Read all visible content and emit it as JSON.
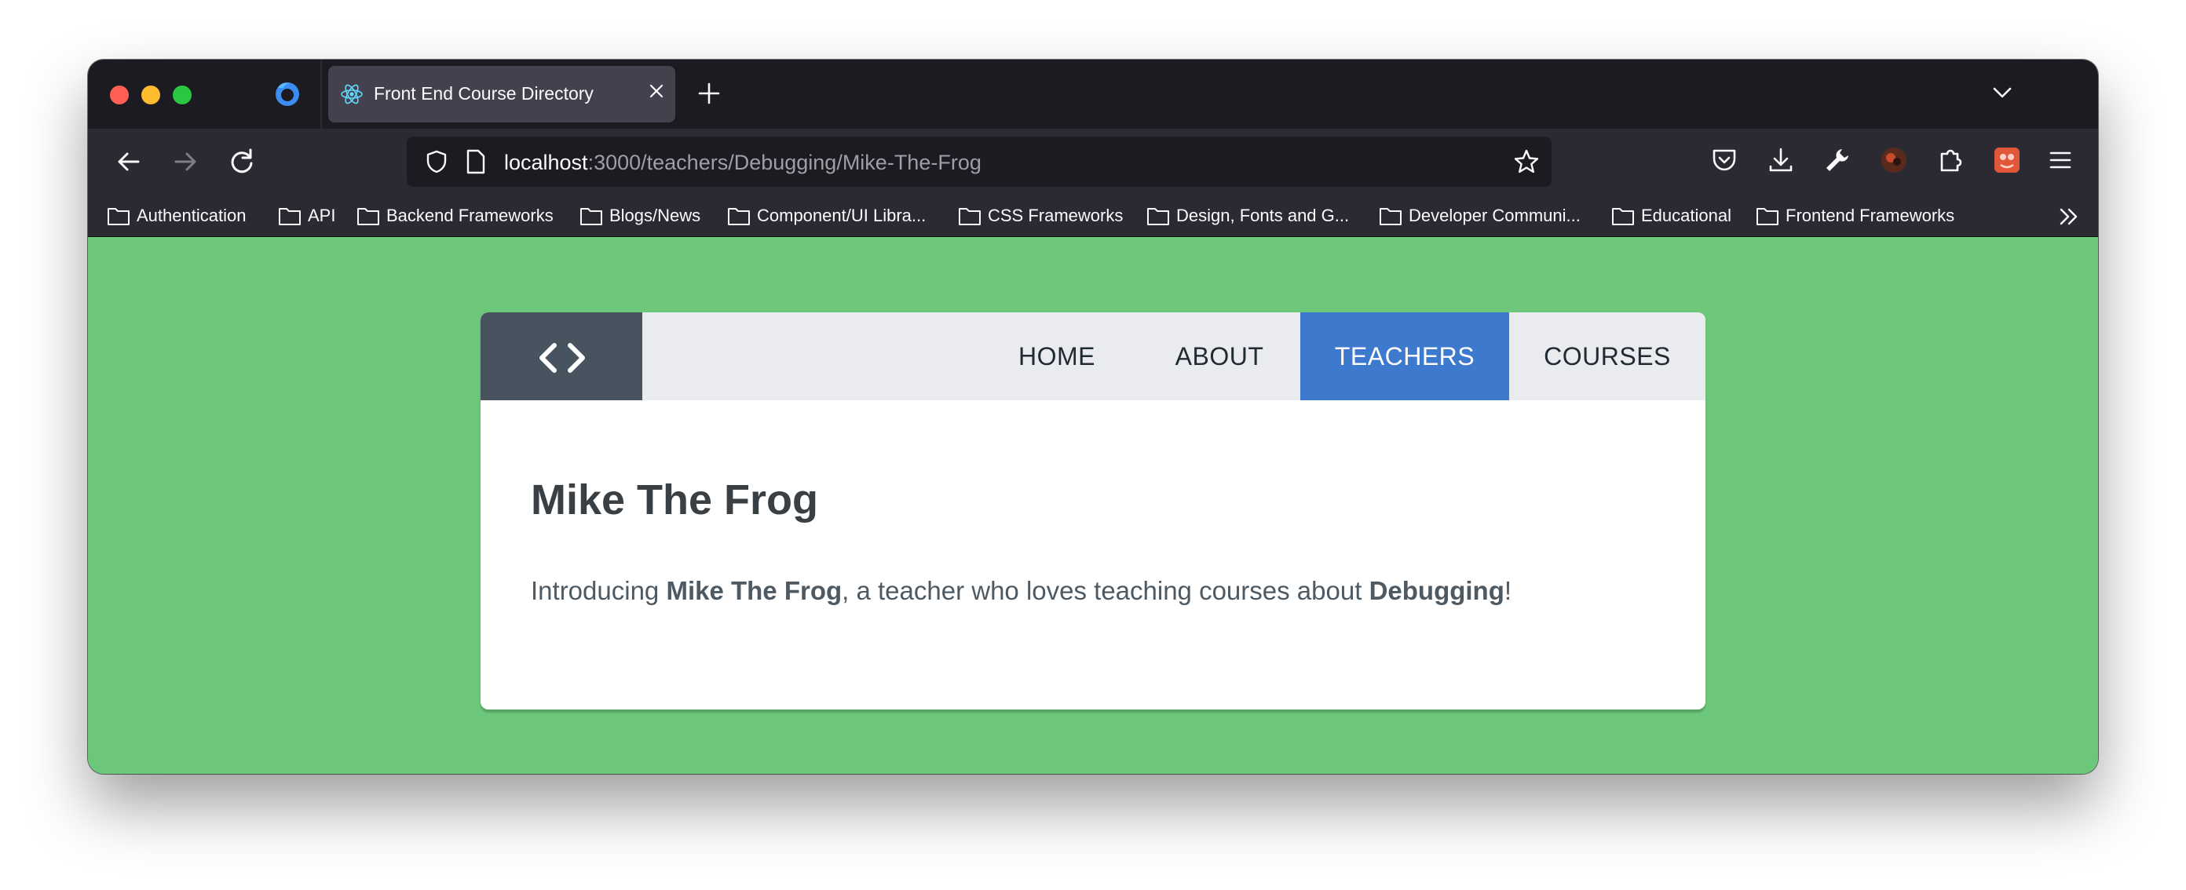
{
  "browser": {
    "tab": {
      "title": "Front End Course Directory"
    },
    "url": {
      "host": "localhost",
      "rest": ":3000/teachers/Debugging/Mike-The-Frog"
    },
    "bookmarks": [
      "Authentication",
      "API",
      "Backend Frameworks",
      "Blogs/News",
      "Component/UI Libra...",
      "CSS Frameworks",
      "Design, Fonts and G...",
      "Developer Communi...",
      "Educational",
      "Frontend Frameworks"
    ]
  },
  "site": {
    "nav": {
      "home": "HOME",
      "about": "ABOUT",
      "teachers": "TEACHERS",
      "courses": "COURSES"
    },
    "active_nav": "TEACHERS",
    "page_title": "Mike The Frog",
    "intro": {
      "prefix": "Introducing ",
      "teacher": "Mike The Frog",
      "middle": ", a teacher who loves teaching courses about ",
      "topic": "Debugging",
      "suffix": "!"
    }
  },
  "colors": {
    "page_background": "#6cc77a",
    "active_nav": "#3d79cc",
    "logo_background": "#47535e",
    "header_background": "#e9ebee"
  },
  "icons": {
    "logo": "code-brackets-icon",
    "tab_favicon": "react-icon"
  }
}
